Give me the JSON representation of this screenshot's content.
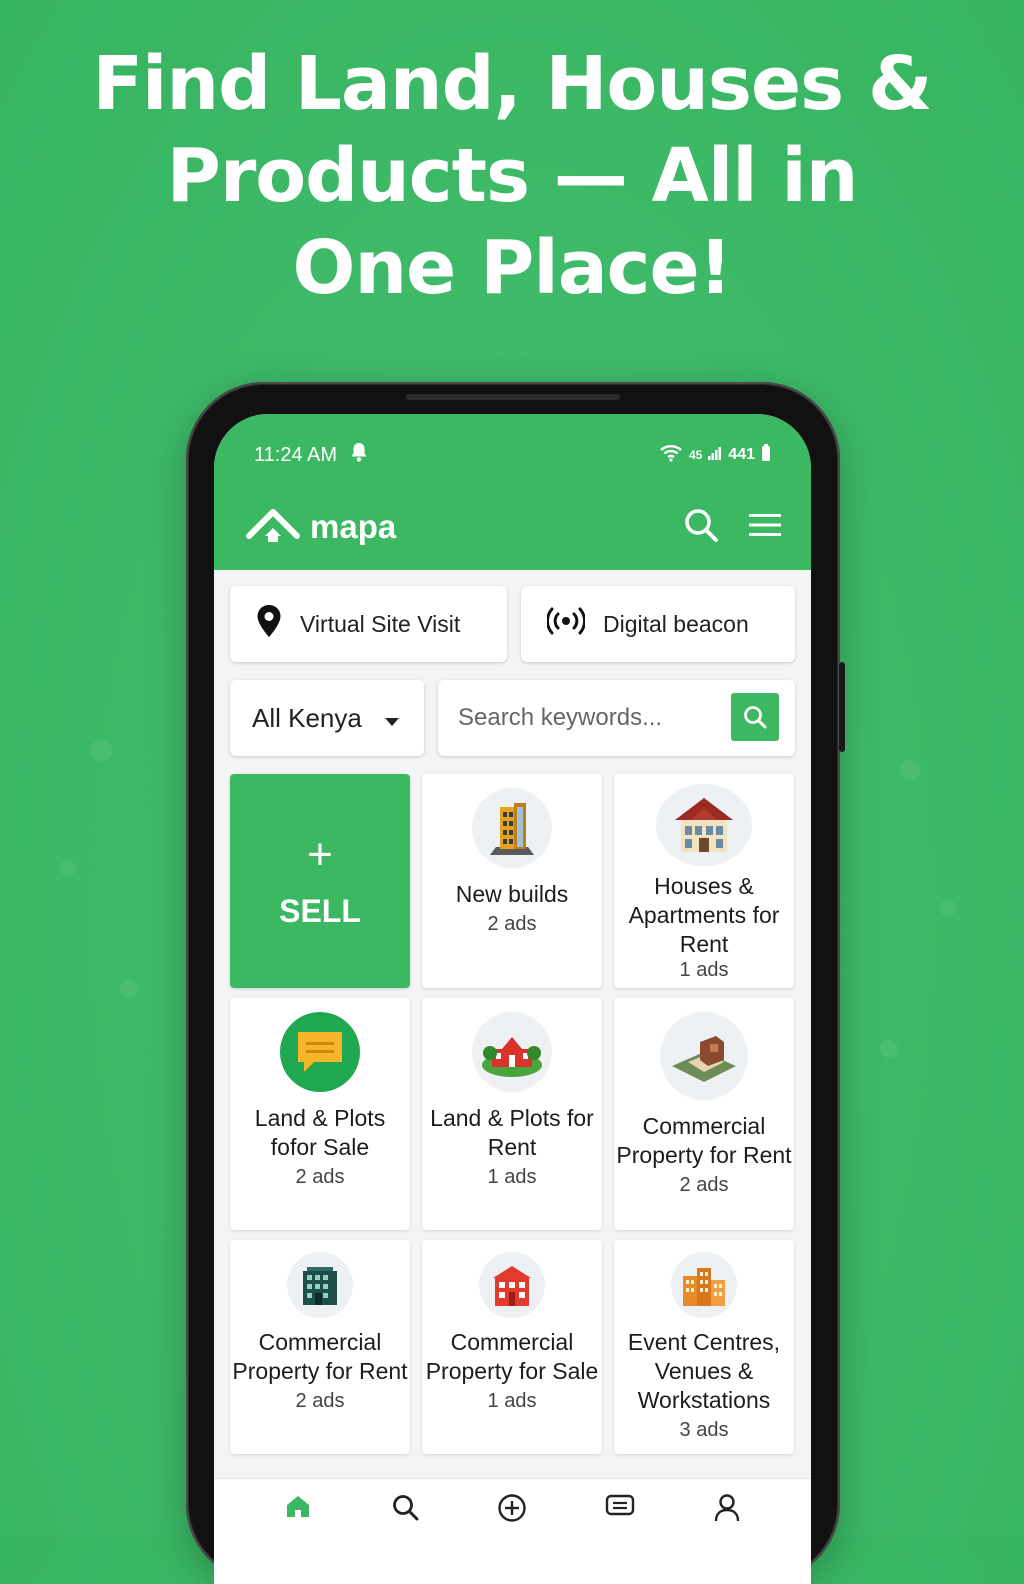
{
  "headline": {
    "line1": "Find Land, Houses &",
    "line2": "Products — All in",
    "line3": "One Place!"
  },
  "status_bar": {
    "time": "11:24 AM",
    "network": "45",
    "battery": "441"
  },
  "app": {
    "logo": "mapa",
    "icons": [
      "search-icon",
      "menu-icon"
    ]
  },
  "quick_actions": {
    "virtual_site_visit": "Virtual Site Visit",
    "digital_beacon": "Digital beacon"
  },
  "filters": {
    "location": "All Kenya",
    "search_placeholder": "Search keywords..."
  },
  "sell_tile": {
    "plus": "+",
    "label": "SELL"
  },
  "categories": [
    {
      "title": "New builds",
      "count": "2 ads",
      "icon": "building-icon"
    },
    {
      "title": "Houses & Apartments for Rent",
      "count": "1 ads",
      "icon": "house-icon"
    },
    {
      "title": "Land & Plots fofor Sale",
      "count": "2 ads",
      "icon": "chat-icon"
    },
    {
      "title": "Land & Plots for Rent",
      "count": "1 ads",
      "icon": "land-icon"
    },
    {
      "title": "Commercial Property for Rent",
      "count": "2 ads",
      "icon": "plot-icon"
    },
    {
      "title": "Commercial Property for Rent",
      "count": "2 ads",
      "icon": "office-icon"
    },
    {
      "title": "Commercial Property for Sale",
      "count": "1 ads",
      "icon": "shop-icon"
    },
    {
      "title": "Event Centres, Venues & Workstations",
      "count": "3 ads",
      "icon": "venue-icon"
    }
  ],
  "bottom_nav": [
    {
      "icon": "home-icon"
    },
    {
      "icon": "search-icon"
    },
    {
      "icon": "add-icon"
    },
    {
      "icon": "messages-icon"
    },
    {
      "icon": "profile-icon"
    }
  ],
  "colors": {
    "brand_green": "#3db862",
    "background_green": "#3db967"
  }
}
